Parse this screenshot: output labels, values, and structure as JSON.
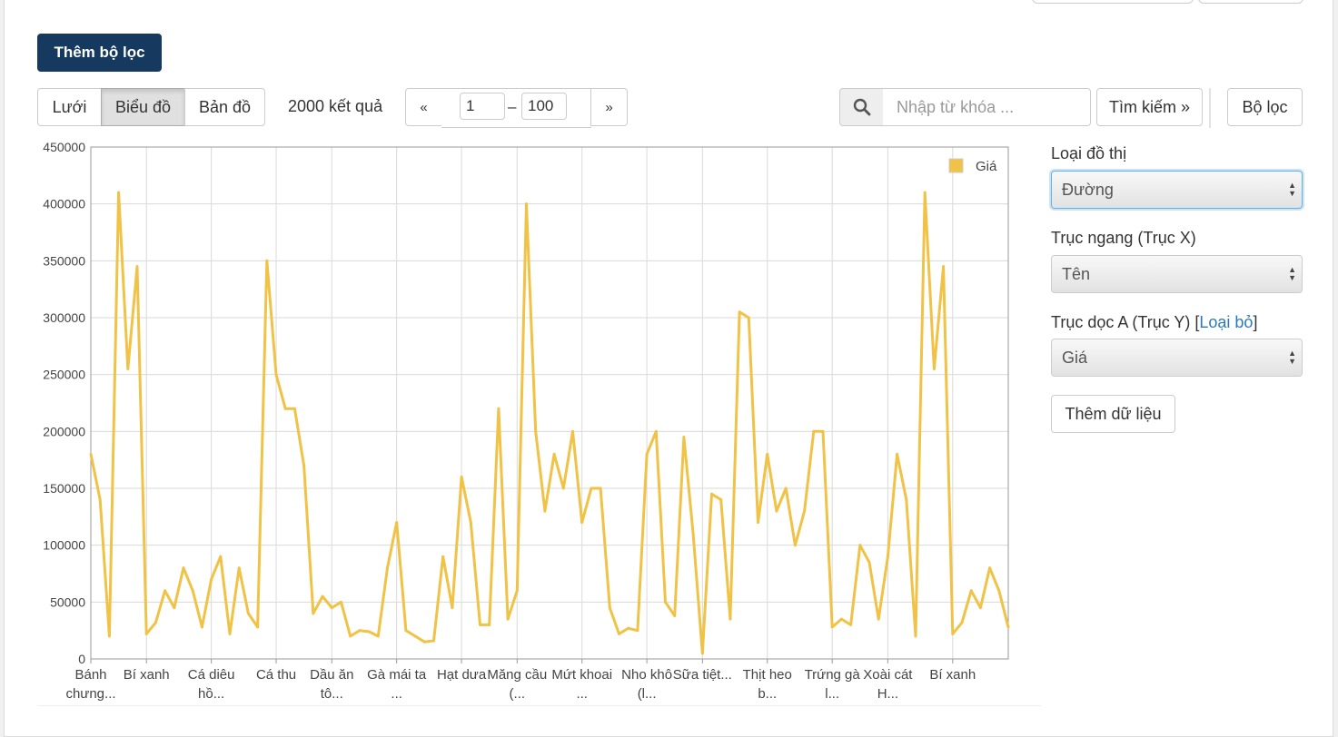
{
  "toolbar": {
    "add_filter": "Thêm bộ lọc",
    "views": [
      "Lưới",
      "Biểu đồ",
      "Bản đồ"
    ],
    "result_count": "2000 kết quả",
    "prev": "«",
    "next": "»",
    "range_from": "1",
    "range_sep": "–",
    "range_to": "100",
    "search_placeholder": "Nhập từ khóa ...",
    "search_button": "Tìm kiếm »",
    "filter_button": "Bộ lọc"
  },
  "side": {
    "chart_type_label": "Loại đồ thị",
    "chart_type_value": "Đường",
    "x_axis_label": "Trục ngang (Trục X)",
    "x_axis_value": "Tên",
    "y_axis_label": "Trục dọc A (Trục Y) [",
    "y_axis_remove": "Loại bỏ",
    "y_axis_label_end": "]",
    "y_axis_value": "Giá",
    "add_data": "Thêm dữ liệu"
  },
  "colors": {
    "series": "#f0c246",
    "primary": "#163a5f",
    "link": "#2a7ac0"
  },
  "icons": {
    "search": "search-icon",
    "select_arrows": "select-arrows-icon"
  },
  "chart_data": {
    "type": "line",
    "ylim": [
      0,
      450000
    ],
    "yticks": [
      0,
      50000,
      100000,
      150000,
      200000,
      250000,
      300000,
      350000,
      400000,
      450000
    ],
    "grid": true,
    "legend": "top-right",
    "categories": [
      [
        "Bánh",
        "chưng..."
      ],
      [
        "Bí xanh"
      ],
      [
        "Cá diêu",
        "hồ..."
      ],
      [
        "Cá thu"
      ],
      [
        "Dầu ăn",
        "tô..."
      ],
      [
        "Gà mái ta",
        "..."
      ],
      [
        "Hạt dưa"
      ],
      [
        "Măng cầu",
        "(..."
      ],
      [
        "Mứt khoai",
        "..."
      ],
      [
        "Nho khô",
        "(l..."
      ],
      [
        "Sữa tiệt..."
      ],
      [
        "Thịt heo",
        "b..."
      ],
      [
        "Trứng gà",
        "l..."
      ],
      [
        "Xoài cát",
        "H..."
      ],
      [
        "Bí xanh"
      ]
    ],
    "category_index": [
      0,
      6,
      13,
      20,
      26,
      33,
      40,
      46,
      53,
      60,
      66,
      73,
      80,
      86,
      93
    ],
    "series": [
      {
        "name": "Giá",
        "values": [
          180000,
          140000,
          20000,
          410000,
          255000,
          345000,
          22000,
          32000,
          60000,
          45000,
          80000,
          60000,
          28000,
          70000,
          90000,
          22000,
          80000,
          40000,
          28000,
          350000,
          250000,
          220000,
          220000,
          170000,
          40000,
          55000,
          45000,
          50000,
          20000,
          25000,
          24000,
          20000,
          80000,
          120000,
          25000,
          20000,
          15000,
          16000,
          90000,
          45000,
          160000,
          120000,
          30000,
          30000,
          220000,
          35000,
          60000,
          400000,
          200000,
          130000,
          180000,
          150000,
          200000,
          120000,
          150000,
          150000,
          45000,
          22000,
          27000,
          25000,
          180000,
          200000,
          50000,
          38000,
          195000,
          110000,
          5000,
          145000,
          140000,
          35000,
          305000,
          300000,
          120000,
          180000,
          130000,
          150000,
          100000,
          130000,
          200000,
          200000,
          28000,
          35000,
          30000,
          100000,
          85000,
          35000,
          90000,
          180000,
          140000,
          20000,
          410000,
          255000,
          345000,
          22000,
          32000,
          60000,
          45000,
          80000,
          60000,
          28000
        ]
      }
    ]
  }
}
